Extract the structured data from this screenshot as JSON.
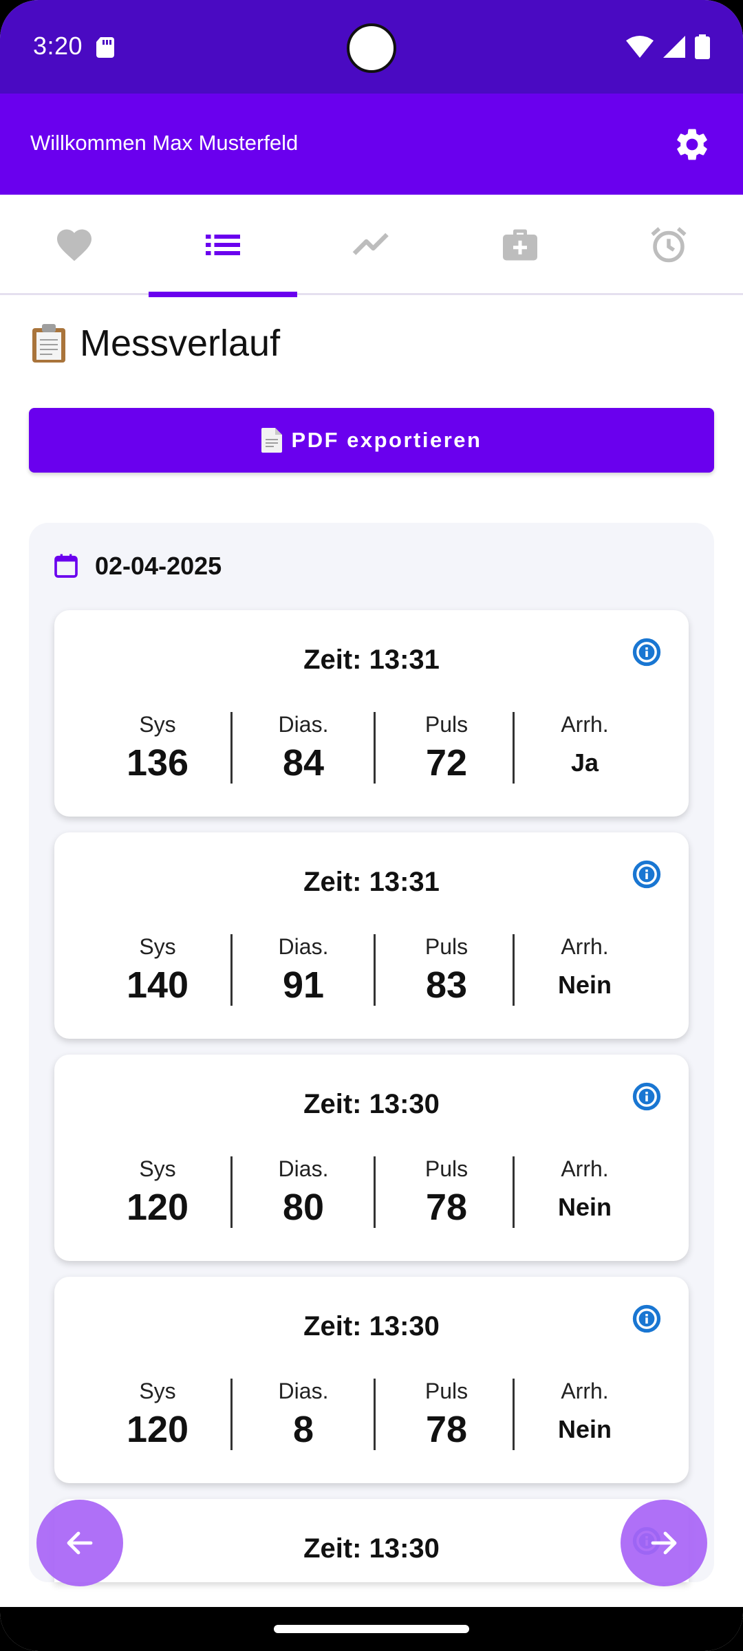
{
  "status_bar": {
    "time": "3:20"
  },
  "app_bar": {
    "welcome": "Willkommen Max Musterfeld"
  },
  "tabs": [
    {
      "name": "heart",
      "active": false
    },
    {
      "name": "list",
      "active": true
    },
    {
      "name": "trend",
      "active": false
    },
    {
      "name": "medkit",
      "active": false
    },
    {
      "name": "alarm",
      "active": false
    }
  ],
  "page": {
    "title": "Messverlauf"
  },
  "export_button": {
    "label": "PDF exportieren"
  },
  "day_group": {
    "date": "02-04-2025"
  },
  "labels": {
    "sys": "Sys",
    "dias": "Dias.",
    "puls": "Puls",
    "arrh": "Arrh."
  },
  "measurements": [
    {
      "time": "Zeit: 13:31",
      "sys": "136",
      "dias": "84",
      "puls": "72",
      "arrh": "Ja"
    },
    {
      "time": "Zeit: 13:31",
      "sys": "140",
      "dias": "91",
      "puls": "83",
      "arrh": "Nein"
    },
    {
      "time": "Zeit: 13:30",
      "sys": "120",
      "dias": "80",
      "puls": "78",
      "arrh": "Nein"
    },
    {
      "time": "Zeit: 13:30",
      "sys": "120",
      "dias": "8",
      "puls": "78",
      "arrh": "Nein"
    },
    {
      "time": "Zeit: 13:30"
    }
  ],
  "colors": {
    "primary": "#6a00ee",
    "status_bar": "#4a0ac2",
    "info_blue": "#1976d2",
    "fab": "#a864f6"
  }
}
